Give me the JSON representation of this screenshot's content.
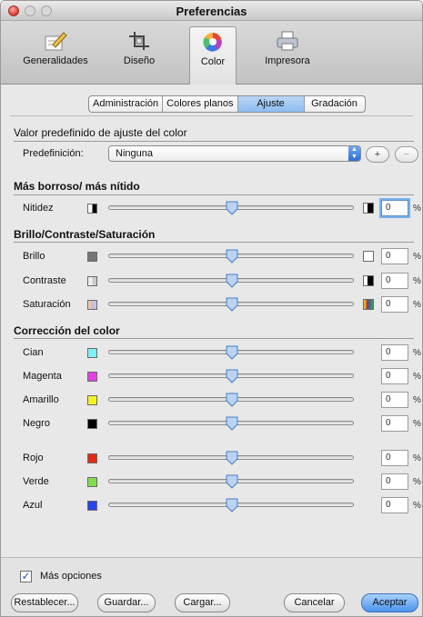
{
  "window": {
    "title": "Preferencias"
  },
  "toolbar": {
    "items": [
      {
        "label": "Generalidades",
        "icon": "pencil-document-icon"
      },
      {
        "label": "Diseño",
        "icon": "crop-icon"
      },
      {
        "label": "Color",
        "icon": "color-wheel-icon",
        "selected": true
      },
      {
        "label": "Impresora",
        "icon": "printer-icon"
      }
    ]
  },
  "tabs": [
    "Administración",
    "Colores planos",
    "Ajuste",
    "Gradación"
  ],
  "active_tab": "Ajuste",
  "preset": {
    "section_title": "Valor predefinido de ajuste del color",
    "label": "Predefinición:",
    "value": "Ninguna",
    "add": "+",
    "remove": "−"
  },
  "sharpness": {
    "section_title": "Más borroso/ más nítido",
    "label": "Nitidez",
    "value": "0",
    "unit": "%",
    "level": 0
  },
  "bcs": {
    "section_title": "Brillo/Contraste/Saturación",
    "rows": [
      {
        "label": "Brillo",
        "value": "0",
        "unit": "%",
        "level": 0
      },
      {
        "label": "Contraste",
        "value": "0",
        "unit": "%",
        "level": 0
      },
      {
        "label": "Saturación",
        "value": "0",
        "unit": "%",
        "level": 0
      }
    ]
  },
  "color_correction": {
    "section_title": "Corrección del color",
    "rows": [
      {
        "label": "Cian",
        "color": "#7ff0f5",
        "value": "0",
        "unit": "%",
        "level": 0
      },
      {
        "label": "Magenta",
        "color": "#e242e2",
        "value": "0",
        "unit": "%",
        "level": 0
      },
      {
        "label": "Amarillo",
        "color": "#f6f21c",
        "value": "0",
        "unit": "%",
        "level": 0
      },
      {
        "label": "Negro",
        "color": "#000000",
        "value": "0",
        "unit": "%",
        "level": 0
      },
      {
        "label": "Rojo",
        "color": "#e42a12",
        "value": "0",
        "unit": "%",
        "level": 0
      },
      {
        "label": "Verde",
        "color": "#7ee048",
        "value": "0",
        "unit": "%",
        "level": 0
      },
      {
        "label": "Azul",
        "color": "#2644f0",
        "value": "0",
        "unit": "%",
        "level": 0
      }
    ]
  },
  "footer": {
    "more_options": "Más opciones",
    "more_checked": true,
    "buttons": [
      "Restablecer...",
      "Guardar...",
      "Cargar...",
      "Cancelar",
      "Aceptar"
    ]
  }
}
